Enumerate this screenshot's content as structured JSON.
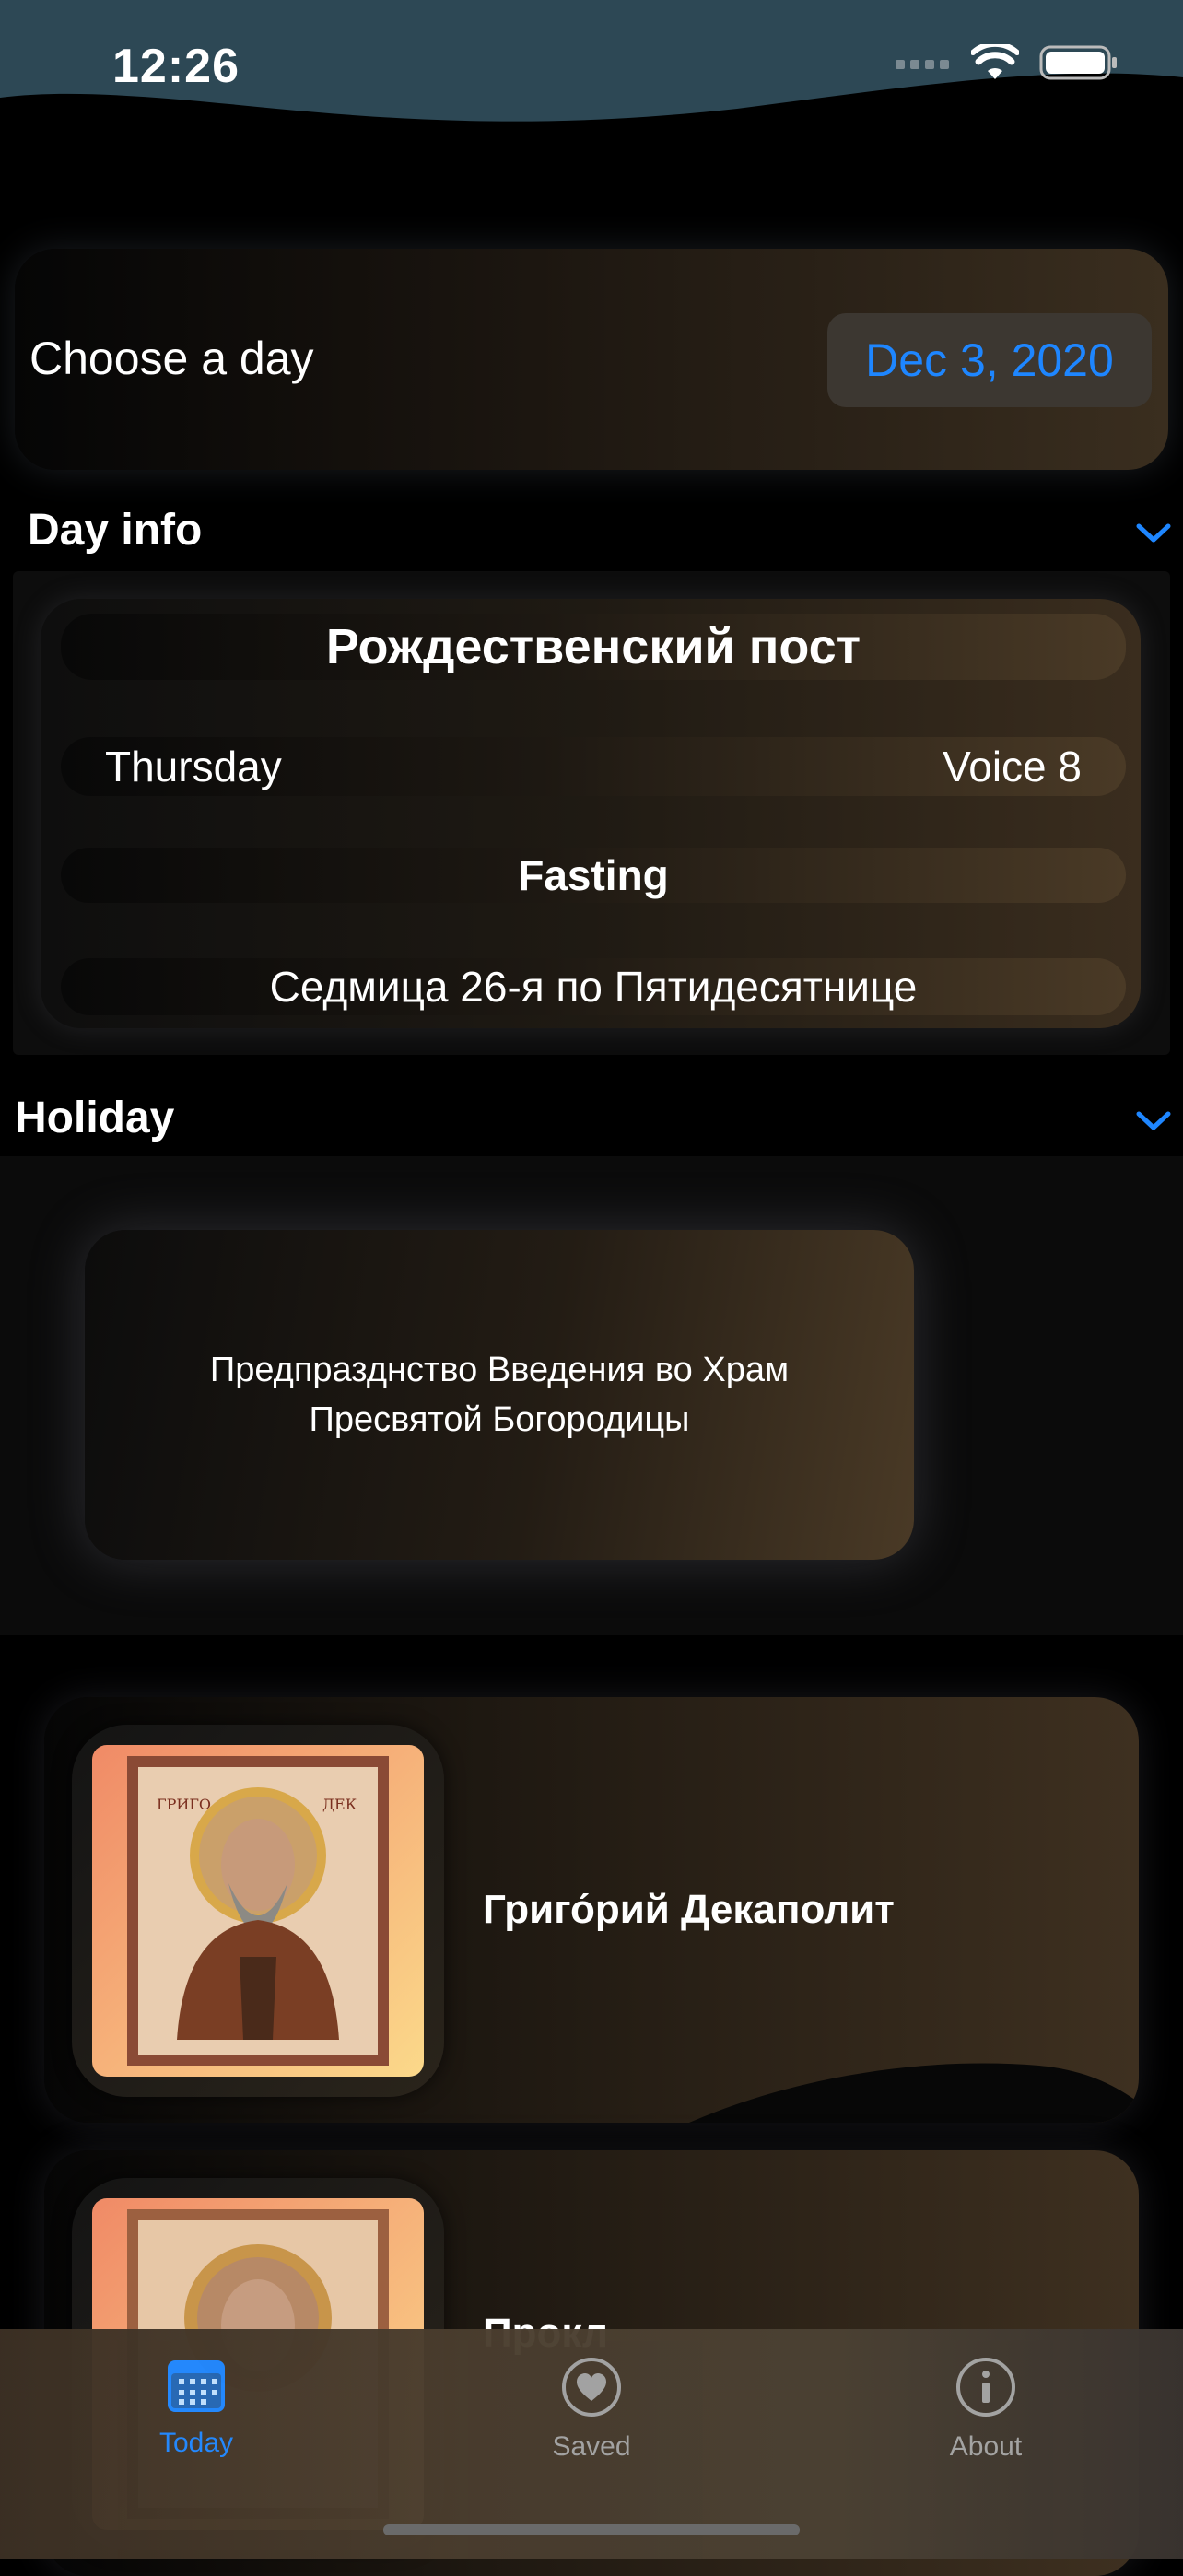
{
  "status_bar": {
    "time": "12:26"
  },
  "choose_day": {
    "label": "Choose a day",
    "date": "Dec 3, 2020"
  },
  "day_info": {
    "heading": "Day info",
    "fast_name": "Рождественский пост",
    "weekday": "Thursday",
    "voice": "Voice 8",
    "fasting": "Fasting",
    "week": "Седмица 26-я по Пятидесятнице"
  },
  "holiday": {
    "heading": "Holiday",
    "text": "Предпразднство Введения во Храм Пресвятой Богородицы"
  },
  "saints": [
    {
      "name": "Григо́рий Декаполит"
    },
    {
      "name": "Прокл"
    }
  ],
  "tabbar": {
    "tabs": [
      {
        "label": "Today",
        "icon": "calendar-icon",
        "active": true
      },
      {
        "label": "Saved",
        "icon": "heart-icon",
        "active": false
      },
      {
        "label": "About",
        "icon": "info-icon",
        "active": false
      }
    ],
    "active_color": "#1e86ff",
    "inactive_color": "#a7a7a7"
  },
  "colors": {
    "accent": "#1e86ff",
    "status_bar_bg": "#2f4a56"
  }
}
